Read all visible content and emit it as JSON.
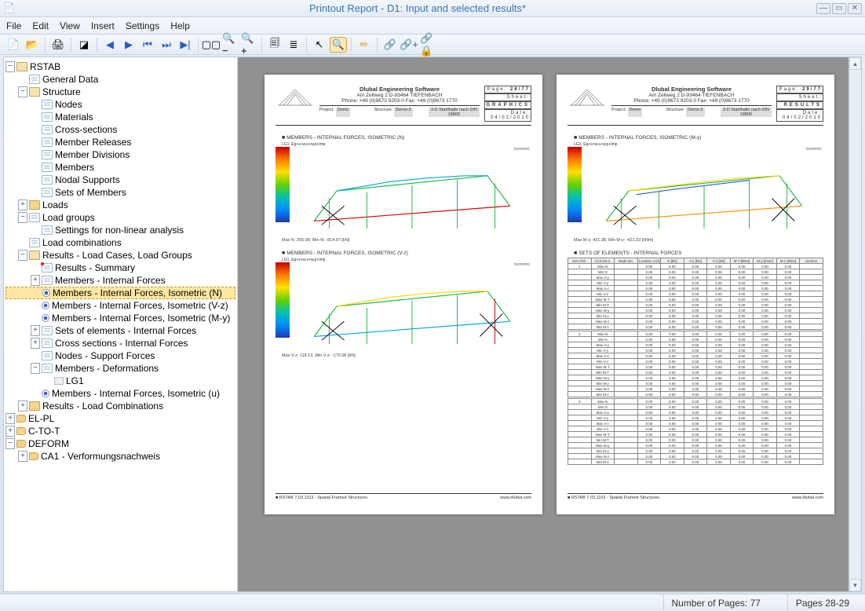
{
  "window": {
    "title": "Printout Report - D1: Input and selected results*"
  },
  "menu": [
    "File",
    "Edit",
    "View",
    "Insert",
    "Settings",
    "Help"
  ],
  "toolbar": [
    {
      "name": "new-document-icon",
      "glyph": "📄"
    },
    {
      "name": "open-icon",
      "glyph": "📂"
    },
    {
      "sep": true
    },
    {
      "name": "print-icon",
      "glyph": "🖨"
    },
    {
      "sep": true
    },
    {
      "name": "layout-icon",
      "glyph": "◪"
    },
    {
      "sep": true
    },
    {
      "name": "nav-first-icon",
      "glyph": "◀",
      "color": "#2a5fbe"
    },
    {
      "name": "nav-prev-icon",
      "glyph": "▶",
      "color": "#2a5fbe"
    },
    {
      "name": "nav-skip-back-icon",
      "glyph": "⏮",
      "color": "#2a5fbe"
    },
    {
      "name": "nav-skip-fwd-icon",
      "glyph": "⏭",
      "color": "#2a5fbe"
    },
    {
      "name": "nav-end-icon",
      "glyph": "▶|",
      "color": "#2a5fbe"
    },
    {
      "sep": true
    },
    {
      "name": "page-spread-icon",
      "glyph": "▢▢"
    },
    {
      "name": "zoom-out-icon",
      "glyph": "🔍−"
    },
    {
      "name": "zoom-in-icon",
      "glyph": "🔍+"
    },
    {
      "sep": true
    },
    {
      "name": "document-stack-icon",
      "glyph": "🗐"
    },
    {
      "name": "page-lines-icon",
      "glyph": "≣"
    },
    {
      "sep": true
    },
    {
      "name": "cursor-icon",
      "glyph": "↖"
    },
    {
      "name": "find-icon",
      "glyph": "🔍",
      "selected": true
    },
    {
      "sep": true
    },
    {
      "name": "edit-icon",
      "glyph": "✏",
      "color": "#e2a300"
    },
    {
      "sep": true
    },
    {
      "name": "link-icon",
      "glyph": "🔗",
      "color": "#2a5fbe"
    },
    {
      "name": "link-add-icon",
      "glyph": "🔗+",
      "color": "#2a5fbe"
    },
    {
      "name": "link-lock-icon",
      "glyph": "🔗🔒",
      "color": "#2a5fbe"
    }
  ],
  "tree": [
    {
      "d": 0,
      "tw": "-",
      "ic": "folder open",
      "label": "RSTAB"
    },
    {
      "d": 1,
      "tw": " ",
      "ic": "doc",
      "label": "General Data"
    },
    {
      "d": 1,
      "tw": "-",
      "ic": "folder open",
      "label": "Structure"
    },
    {
      "d": 2,
      "tw": " ",
      "ic": "doc",
      "label": "Nodes"
    },
    {
      "d": 2,
      "tw": " ",
      "ic": "doc",
      "label": "Materials"
    },
    {
      "d": 2,
      "tw": " ",
      "ic": "doc",
      "label": "Cross-sections"
    },
    {
      "d": 2,
      "tw": " ",
      "ic": "doc",
      "label": "Member Releases"
    },
    {
      "d": 2,
      "tw": " ",
      "ic": "doc",
      "label": "Member Divisions"
    },
    {
      "d": 2,
      "tw": " ",
      "ic": "doc",
      "label": "Members"
    },
    {
      "d": 2,
      "tw": " ",
      "ic": "doc",
      "label": "Nodal Supports"
    },
    {
      "d": 2,
      "tw": " ",
      "ic": "doc",
      "label": "Sets of Members"
    },
    {
      "d": 1,
      "tw": "+",
      "ic": "folder",
      "label": "Loads"
    },
    {
      "d": 1,
      "tw": "-",
      "ic": "doc",
      "label": "Load groups"
    },
    {
      "d": 2,
      "tw": " ",
      "ic": "doc",
      "label": "Settings for non-linear analysis"
    },
    {
      "d": 1,
      "tw": " ",
      "ic": "doc",
      "label": "Load combinations"
    },
    {
      "d": 1,
      "tw": "-",
      "ic": "folder open",
      "label": "Results - Load Cases, Load Groups"
    },
    {
      "d": 2,
      "tw": " ",
      "ic": "doc",
      "hasRed": true,
      "label": "Results - Summary"
    },
    {
      "d": 2,
      "tw": "+",
      "ic": "doc",
      "label": "Members - Internal Forces"
    },
    {
      "d": 2,
      "tw": " ",
      "ic": "eye",
      "label": "Members - Internal Forces, Isometric  (N)",
      "selected": true
    },
    {
      "d": 2,
      "tw": " ",
      "ic": "eye",
      "label": "Members - Internal Forces, Isometric (V-z)"
    },
    {
      "d": 2,
      "tw": " ",
      "ic": "eye",
      "label": "Members - Internal Forces, Isometric (M-y)"
    },
    {
      "d": 2,
      "tw": "+",
      "ic": "doc",
      "label": "Sets of elements - Internal Forces"
    },
    {
      "d": 2,
      "tw": "+",
      "ic": "doc",
      "label": "Cross sections - Internal Forces"
    },
    {
      "d": 2,
      "tw": " ",
      "ic": "doc",
      "label": "Nodes - Support Forces"
    },
    {
      "d": 2,
      "tw": "-",
      "ic": "doc",
      "label": "Members - Deformations"
    },
    {
      "d": 3,
      "tw": " ",
      "ic": "lg1",
      "label": "LG1"
    },
    {
      "d": 2,
      "tw": " ",
      "ic": "eye",
      "label": "Members - Internal Forces, Isometric (u)"
    },
    {
      "d": 1,
      "tw": "+",
      "ic": "folder",
      "label": "Results - Load Combinations"
    },
    {
      "d": 0,
      "tw": "+",
      "ic": "tag",
      "label": "EL-PL"
    },
    {
      "d": 0,
      "tw": "+",
      "ic": "tag",
      "label": "C-TO-T"
    },
    {
      "d": 0,
      "tw": "-",
      "ic": "tag",
      "label": "DEFORM"
    },
    {
      "d": 1,
      "tw": "+",
      "ic": "tag",
      "label": "CA1 - Verformungsnachweis"
    }
  ],
  "page_common": {
    "company": "Dlubal Engineering Software",
    "address": "Am Zellweg 2  D-93464 TIEFENBACH",
    "phone": "Phone: +49 (0)9673 9203-0  Fax: +49 (0)9673 1770",
    "project_label": "Project:",
    "project": "Demo",
    "structure_label": "Structure:",
    "structure": "Demo-5",
    "desc": "3-D Stahlhalle nach DIN 18800",
    "page_label": "Page:",
    "sheet_label": "Sheet:",
    "date_label": "Date:",
    "date": "04/02/2010",
    "version": "RSTAB 7.03.1103 - Spatial Framed Structures",
    "site": "www.dlubal.com",
    "iso_label": "Isometric",
    "lg": "LG1: Eg+s+w,s+w,p+Imp"
  },
  "page_left": {
    "index": "28/77",
    "type": "GRAPHICS",
    "sec1": "MEMBERS - INTERNAL FORCES, ISOMETRIC  (N)",
    "axis1": "N",
    "cap1": "Max N: 255.09, Min N: -814.07 [kN]",
    "sec2": "MEMBERS - INTERNAL FORCES, ISOMETRIC  (V-z)",
    "axis2": "V-z",
    "cap2": "Max V-z: 118.13, Min V-z: -170.06 [kN]"
  },
  "page_right": {
    "index": "29/77",
    "type": "RESULTS",
    "sec1": "MEMBERS - INTERNAL FORCES, ISOMETRIC  (M-y)",
    "axis1": "M-y",
    "cap1": "Max M-y: 421.38, Min M-y: -421.33 [kNm]",
    "sec2": "SETS OF ELEMENTS - INTERNAL FORCES",
    "table_head": [
      "Set of El.",
      "LC/LG/LC",
      "Node No.",
      "Location x [m]",
      "N [kN]",
      "V-y [kN]",
      "V-z [kN]",
      "M-T [kNm]",
      "M-y [kNm]",
      "M-z [kNm]",
      "Section"
    ],
    "table_groups": [
      [
        "1",
        "Max N",
        "",
        "",
        "",
        "",
        "",
        "",
        "",
        "",
        ""
      ],
      [
        "",
        "Min N",
        "",
        "",
        "",
        "",
        "",
        "",
        "",
        "",
        ""
      ],
      [
        "",
        "Max V-y",
        "",
        "",
        "",
        "",
        "",
        "",
        "",
        "",
        ""
      ],
      [
        "",
        "Min V-y",
        "",
        "",
        "",
        "",
        "",
        "",
        "",
        "",
        ""
      ],
      [
        "",
        "Max V-z",
        "",
        "",
        "",
        "",
        "",
        "",
        "",
        "",
        ""
      ],
      [
        "",
        "Min V-z",
        "",
        "",
        "",
        "",
        "",
        "",
        "",
        "",
        ""
      ],
      [
        "",
        "Max M-T",
        "",
        "",
        "",
        "",
        "",
        "",
        "",
        "",
        ""
      ],
      [
        "",
        "Min M-T",
        "",
        "",
        "",
        "",
        "",
        "",
        "",
        "",
        ""
      ],
      [
        "",
        "Max M-y",
        "",
        "",
        "",
        "",
        "",
        "",
        "",
        "",
        ""
      ],
      [
        "",
        "Min M-y",
        "",
        "",
        "",
        "",
        "",
        "",
        "",
        "",
        ""
      ],
      [
        "",
        "Max M-z",
        "",
        "",
        "",
        "",
        "",
        "",
        "",
        "",
        ""
      ],
      [
        "",
        "Min M-z",
        "",
        "",
        "",
        "",
        "",
        "",
        "",
        "",
        ""
      ]
    ]
  },
  "status": {
    "pages_total_label": "Number of Pages:",
    "pages_total": "77",
    "pages_current_label": "Pages",
    "pages_current": "28-29"
  }
}
